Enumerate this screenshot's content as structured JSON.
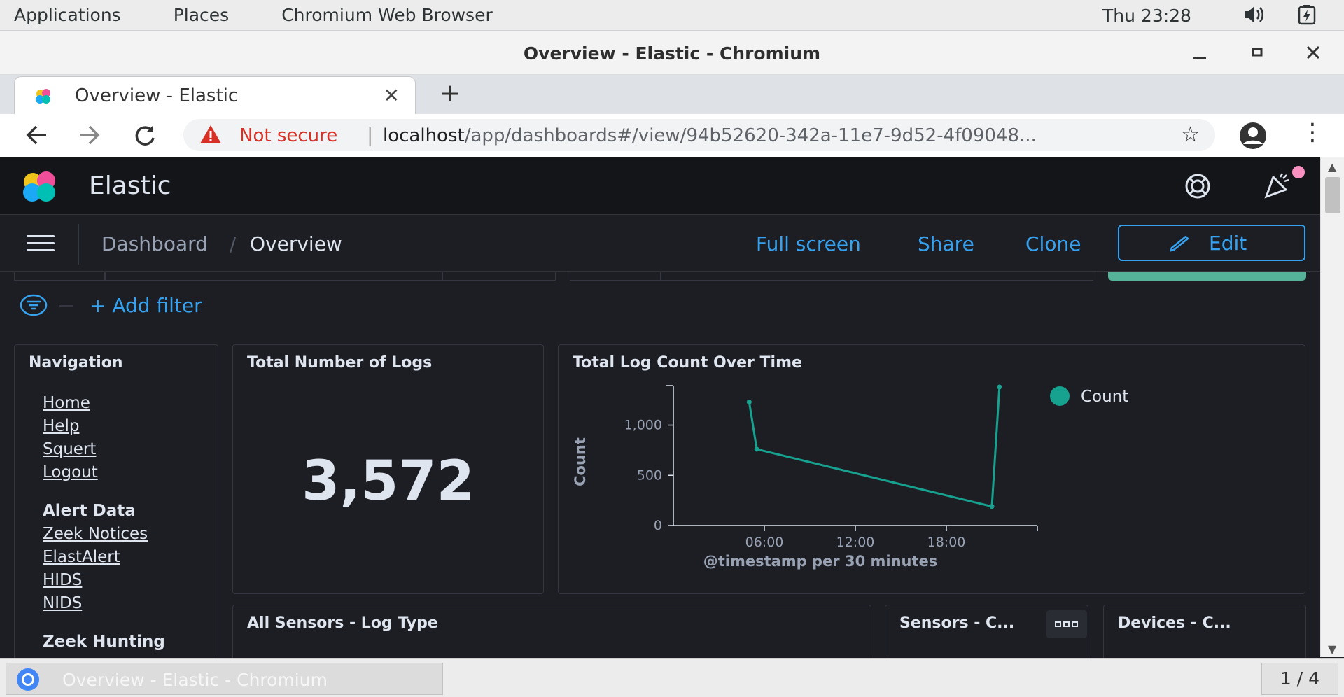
{
  "topbar": {
    "menus": [
      "Applications",
      "Places",
      "Chromium Web Browser"
    ],
    "clock": "Thu 23:28",
    "icons": [
      "volume-icon",
      "battery-icon"
    ]
  },
  "window": {
    "title": "Overview - Elastic - Chromium"
  },
  "tabs": [
    {
      "label": "Overview - Elastic",
      "favicon": "elastic-icon",
      "active": true
    }
  ],
  "address_bar": {
    "security_label": "Not secure",
    "host": "localhost",
    "path": "/app/dashboards#/view/94b52620-342a-11e7-9d52-4f09048..."
  },
  "kibana": {
    "app_name": "Elastic",
    "breadcrumbs": [
      "Dashboard",
      "Overview"
    ],
    "crumb_separator": "/",
    "actions": {
      "full_screen": "Full screen",
      "share": "Share",
      "clone": "Clone",
      "edit": "Edit"
    },
    "add_filter": "+ Add filter"
  },
  "panels": {
    "navigation": {
      "title": "Navigation",
      "links": [
        "Home",
        "Help",
        "Squert",
        "Logout"
      ],
      "alert_heading": "Alert Data",
      "alert_links": [
        "Zeek Notices",
        "ElastAlert",
        "HIDS",
        "NIDS"
      ],
      "zeek_heading": "Zeek Hunting"
    },
    "total_logs": {
      "title": "Total Number of Logs",
      "value": "3,572"
    },
    "log_count_over_time": {
      "title": "Total Log Count Over Time"
    },
    "all_sensors": {
      "title": "All Sensors - Log Type"
    },
    "sensors": {
      "title": "Sensors - C..."
    },
    "devices": {
      "title": "Devices - C..."
    }
  },
  "chart_data": {
    "type": "line",
    "title": "Total Log Count Over Time",
    "xlabel": "@timestamp per 30 minutes",
    "ylabel": "Count",
    "x_ticks": [
      "06:00",
      "12:00",
      "18:00"
    ],
    "y_ticks": [
      "0",
      "500",
      "1,000"
    ],
    "ylim": [
      0,
      1380
    ],
    "xlim_hours": [
      0.0,
      24.0
    ],
    "series": [
      {
        "name": "Count",
        "color": "#16a28f",
        "points": [
          {
            "x_hours": 5.0,
            "y": 1230
          },
          {
            "x_hours": 5.5,
            "y": 760
          },
          {
            "x_hours": 21.0,
            "y": 190
          },
          {
            "x_hours": 21.5,
            "y": 1380
          }
        ]
      }
    ],
    "legend": "top-right",
    "grid": false
  },
  "taskbar": {
    "item": "Overview - Elastic - Chromium",
    "pager": "1 / 4"
  }
}
